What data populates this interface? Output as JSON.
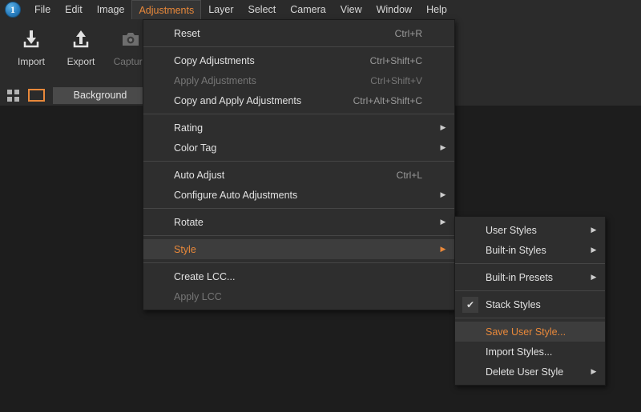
{
  "menubar": {
    "logo": {
      "icon": "app-logo-icon",
      "text": "1"
    },
    "items": [
      {
        "label": "File",
        "active": false
      },
      {
        "label": "Edit",
        "active": false
      },
      {
        "label": "Image",
        "active": false
      },
      {
        "label": "Adjustments",
        "active": true
      },
      {
        "label": "Layer",
        "active": false
      },
      {
        "label": "Select",
        "active": false
      },
      {
        "label": "Camera",
        "active": false
      },
      {
        "label": "View",
        "active": false
      },
      {
        "label": "Window",
        "active": false
      },
      {
        "label": "Help",
        "active": false
      }
    ]
  },
  "toolbar": {
    "buttons": [
      {
        "label": "Import",
        "icon": "import-download-arrow-icon",
        "disabled": false
      },
      {
        "label": "Export",
        "icon": "export-upload-arrow-icon",
        "disabled": false
      },
      {
        "label": "Capture",
        "icon": "camera-icon",
        "disabled": true
      }
    ]
  },
  "layerbar": {
    "grid_icon": "grid-view-icon",
    "rect_icon": "selected-layer-icon",
    "tab_label": "Background"
  },
  "adjustments_menu": {
    "items": [
      {
        "label": "Reset",
        "accel": "Ctrl+R",
        "arrow": false,
        "disabled": false,
        "highlight": false
      },
      {
        "sep": true
      },
      {
        "label": "Copy Adjustments",
        "accel": "Ctrl+Shift+C",
        "arrow": false,
        "disabled": false,
        "highlight": false
      },
      {
        "label": "Apply Adjustments",
        "accel": "Ctrl+Shift+V",
        "arrow": false,
        "disabled": true,
        "highlight": false
      },
      {
        "label": "Copy and Apply Adjustments",
        "accel": "Ctrl+Alt+Shift+C",
        "arrow": false,
        "disabled": false,
        "highlight": false
      },
      {
        "sep": true
      },
      {
        "label": "Rating",
        "accel": "",
        "arrow": true,
        "disabled": false,
        "highlight": false
      },
      {
        "label": "Color Tag",
        "accel": "",
        "arrow": true,
        "disabled": false,
        "highlight": false
      },
      {
        "sep": true
      },
      {
        "label": "Auto Adjust",
        "accel": "Ctrl+L",
        "arrow": false,
        "disabled": false,
        "highlight": false
      },
      {
        "label": "Configure Auto Adjustments",
        "accel": "",
        "arrow": true,
        "disabled": false,
        "highlight": false
      },
      {
        "sep": true
      },
      {
        "label": "Rotate",
        "accel": "",
        "arrow": true,
        "disabled": false,
        "highlight": false
      },
      {
        "sep": true
      },
      {
        "label": "Style",
        "accel": "",
        "arrow": true,
        "disabled": false,
        "highlight": true
      },
      {
        "sep": true
      },
      {
        "label": "Create LCC...",
        "accel": "",
        "arrow": false,
        "disabled": false,
        "highlight": false
      },
      {
        "label": "Apply LCC",
        "accel": "",
        "arrow": false,
        "disabled": true,
        "highlight": false
      }
    ]
  },
  "style_submenu": {
    "items": [
      {
        "label": "User Styles",
        "arrow": true,
        "checked": false,
        "highlight": false
      },
      {
        "label": "Built-in Styles",
        "arrow": true,
        "checked": false,
        "highlight": false
      },
      {
        "sep": true
      },
      {
        "label": "Built-in Presets",
        "arrow": true,
        "checked": false,
        "highlight": false
      },
      {
        "sep": true
      },
      {
        "label": "Stack Styles",
        "arrow": false,
        "checked": true,
        "highlight": false
      },
      {
        "sep": true
      },
      {
        "label": "Save User Style...",
        "arrow": false,
        "checked": false,
        "highlight": true
      },
      {
        "label": "Import Styles...",
        "arrow": false,
        "checked": false,
        "highlight": false
      },
      {
        "label": "Delete User Style",
        "arrow": true,
        "checked": false,
        "highlight": false
      }
    ]
  },
  "colors": {
    "accent_orange": "#e8883a",
    "menu_bg": "#2e2e2e",
    "chrome_bg": "#2b2b2b",
    "canvas_bg": "#1d1d1d",
    "highlight_bg": "#3d3d3d",
    "text": "#e2e2e2",
    "text_disabled": "#767676",
    "logo_blue": "#2a7fc0"
  },
  "icons": {
    "submenu_arrow": "▶",
    "checkmark": "✔"
  }
}
